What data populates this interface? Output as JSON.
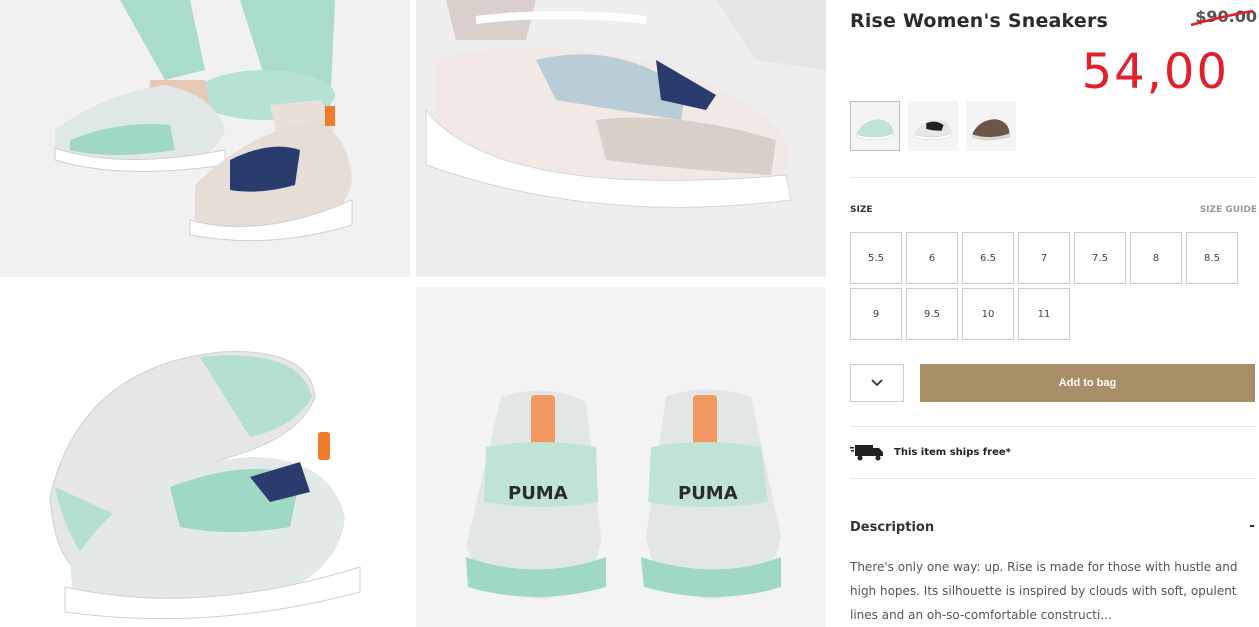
{
  "product": {
    "title": "Rise Women's Sneakers",
    "old_price": "$90.00",
    "new_price": "54,00"
  },
  "colors": {
    "accent": "#a98f68",
    "sale": "#e41e2b"
  },
  "swatches": [
    {
      "name": "mint-pink"
    },
    {
      "name": "white-black"
    },
    {
      "name": "brown"
    }
  ],
  "size_section": {
    "label": "SIZE",
    "guide": "SIZE GUIDE",
    "sizes": [
      "5.5",
      "6",
      "6.5",
      "7",
      "7.5",
      "8",
      "8.5",
      "9",
      "9.5",
      "10",
      "11"
    ]
  },
  "cart": {
    "add_label": "Add to bag",
    "qty_icon": "chevron-down-icon"
  },
  "shipping": {
    "icon": "truck-icon",
    "text": "This item ships free*"
  },
  "description": {
    "heading": "Description",
    "toggle": "-",
    "text": "There's only one way: up. Rise is made for those with hustle and high hopes. Its silhouette is inspired by clouds with soft, opulent lines and an oh-so-comfortable constructi..."
  }
}
